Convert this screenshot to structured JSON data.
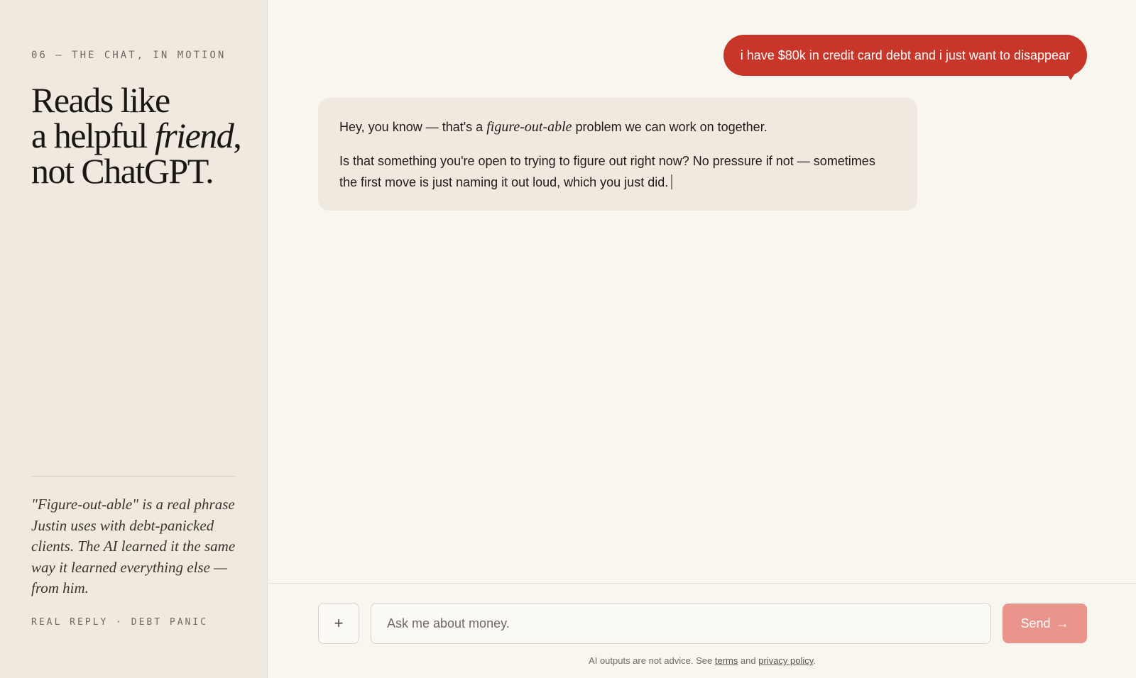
{
  "sidebar": {
    "eyebrow": "06 — THE CHAT, IN MOTION",
    "headline": {
      "line1": "Reads like",
      "line2_pre": "a helpful ",
      "line2_em": "friend",
      "line2_post": ",",
      "line3": "not ChatGPT."
    },
    "quote": "\"Figure-out-able\" is a real phrase Justin uses with debt-panicked clients. The AI learned it the same way it learned everything else — from him.",
    "caption": "REAL REPLY · DEBT PANIC"
  },
  "chat": {
    "user_message": "i have $80k in credit card debt and i just want to disappear",
    "assistant": {
      "p1_pre": "Hey, you know — that's a ",
      "p1_em": "figure-out-able",
      "p1_post": " problem we can work on together.",
      "p2": "Is that something you're open to trying to figure out right now? No pressure if not — sometimes the first move is just naming it out loud, which you just did."
    }
  },
  "composer": {
    "attach_icon": "plus-icon",
    "attach_glyph": "+",
    "placeholder": "Ask me about money.",
    "value": "",
    "send_label": "Send",
    "send_arrow": "→"
  },
  "footer": {
    "pre": "AI outputs are not advice. See ",
    "terms_label": "terms",
    "mid": " and ",
    "privacy_label": "privacy policy",
    "post": "."
  },
  "colors": {
    "accent": "#c8362a",
    "send_button": "#e9958b",
    "sidebar_bg": "#efe9df",
    "page_bg": "#f9f6f0"
  }
}
